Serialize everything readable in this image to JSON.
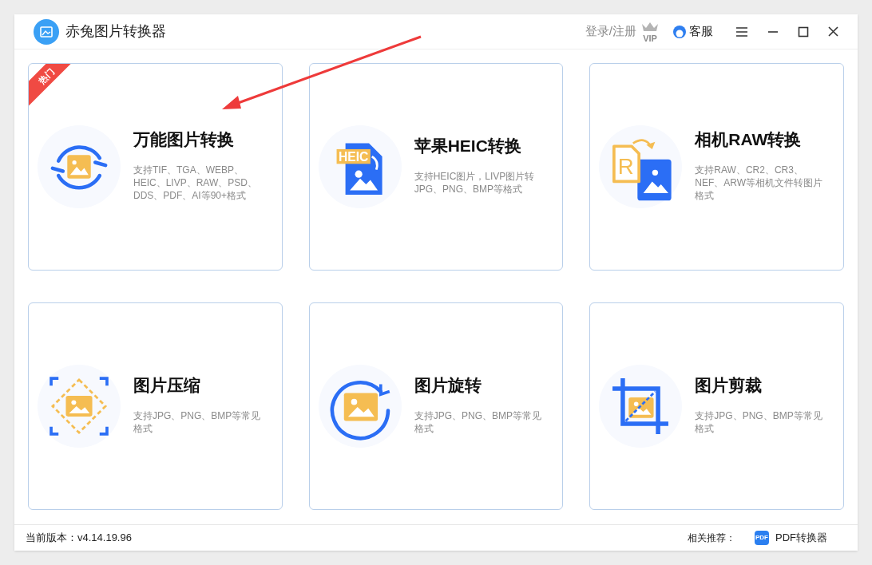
{
  "window": {
    "title": "赤兔图片转换器"
  },
  "header": {
    "login": "登录/注册",
    "vip": "VIP",
    "service": "客服"
  },
  "cards": [
    {
      "kind": "convert",
      "badge": "热门",
      "title": "万能图片转换",
      "description": "支持TIF、TGA、WEBP、HEIC、LIVP、RAW、PSD、DDS、PDF、AI等90+格式"
    },
    {
      "kind": "heic",
      "icon_label": "HEIC",
      "title": "苹果HEIC转换",
      "description": "支持HEIC图片，LIVP图片转JPG、PNG、BMP等格式"
    },
    {
      "kind": "raw",
      "icon_label": "R",
      "title": "相机RAW转换",
      "description": "支持RAW、CR2、CR3、NEF、ARW等相机文件转图片格式"
    },
    {
      "kind": "compress",
      "title": "图片压缩",
      "description": "支持JPG、PNG、BMP等常见格式"
    },
    {
      "kind": "rotate",
      "title": "图片旋转",
      "description": "支持JPG、PNG、BMP等常见格式"
    },
    {
      "kind": "crop",
      "title": "图片剪裁",
      "description": "支持JPG、PNG、BMP等常见格式"
    }
  ],
  "status_bar": {
    "version": "当前版本：v4.14.19.96",
    "recommend_label": "相关推荐：",
    "recommend_icon_label": "PDF",
    "recommend_link": "PDF转换器"
  }
}
